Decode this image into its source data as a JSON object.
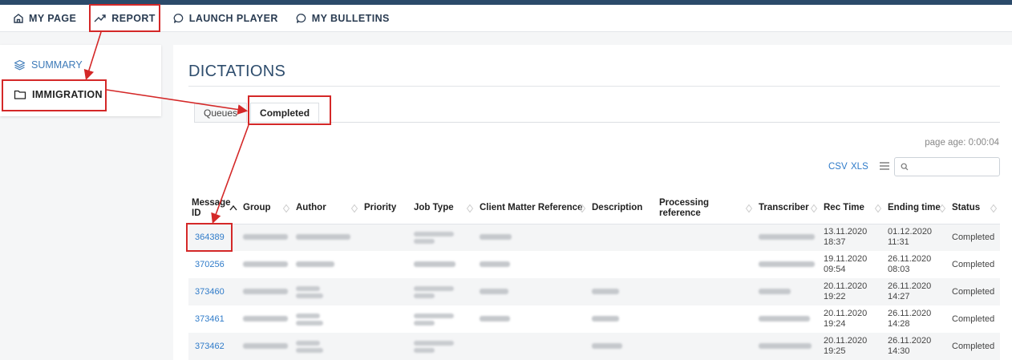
{
  "nav": {
    "items": [
      {
        "label": "MY PAGE",
        "icon": "home-icon"
      },
      {
        "label": "REPORT",
        "icon": "trend-icon"
      },
      {
        "label": "LAUNCH PLAYER",
        "icon": "chat-icon"
      },
      {
        "label": "MY BULLETINS",
        "icon": "chat-icon"
      }
    ]
  },
  "sidebar": {
    "items": [
      {
        "label": "SUMMARY",
        "icon": "layers-icon"
      },
      {
        "label": "IMMIGRATION",
        "icon": "folder-icon"
      }
    ]
  },
  "main": {
    "title": "DICTATIONS",
    "tabs": [
      {
        "label": "Queues"
      },
      {
        "label": "Completed"
      }
    ],
    "page_age": "page age: 0:00:04",
    "export": {
      "csv": "CSV",
      "xls": "XLS"
    },
    "search": {
      "placeholder": ""
    }
  },
  "table": {
    "headers": [
      "Message ID",
      "Group",
      "Author",
      "Priority",
      "Job Type",
      "Client Matter Reference",
      "Description",
      "Processing reference",
      "Transcriber",
      "Rec Time",
      "Ending time",
      "Status"
    ],
    "rows": [
      {
        "id": "364389",
        "rec": "13.11.2020 18:37",
        "end": "01.12.2020 11:31",
        "status": "Completed"
      },
      {
        "id": "370256",
        "rec": "19.11.2020 09:54",
        "end": "26.11.2020 08:03",
        "status": "Completed"
      },
      {
        "id": "373460",
        "rec": "20.11.2020 19:22",
        "end": "26.11.2020 14:27",
        "status": "Completed"
      },
      {
        "id": "373461",
        "rec": "20.11.2020 19:24",
        "end": "26.11.2020 14:28",
        "status": "Completed"
      },
      {
        "id": "373462",
        "rec": "20.11.2020 19:25",
        "end": "26.11.2020 14:30",
        "status": "Completed"
      }
    ]
  },
  "colors": {
    "accent": "#2f7bc9",
    "nav_text": "#2a3c52",
    "annotation": "#d42828"
  }
}
